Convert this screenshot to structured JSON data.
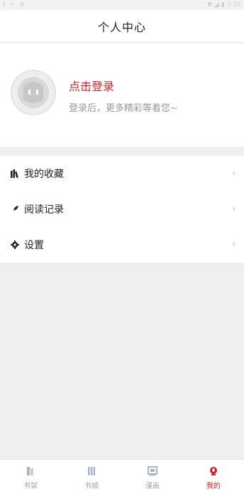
{
  "status_bar": {
    "left_icons": [
      "info-icon",
      "plus-icon",
      "settings-icon"
    ],
    "time": "3:28"
  },
  "header": {
    "title": "个人中心"
  },
  "profile": {
    "login_label": "点击登录",
    "login_subtitle": "登录后，更多精彩等着您~",
    "login_color": "#d0202a"
  },
  "menu": {
    "items": [
      {
        "label": "我的收藏",
        "icon": "books-icon"
      },
      {
        "label": "阅读记录",
        "icon": "feather-icon"
      },
      {
        "label": "设置",
        "icon": "gear-icon"
      }
    ],
    "chevron": "›"
  },
  "tabbar": {
    "items": [
      {
        "label": "书架",
        "icon": "bookshelf-icon"
      },
      {
        "label": "书城",
        "icon": "bookstore-icon"
      },
      {
        "label": "漫画",
        "icon": "comic-icon"
      },
      {
        "label": "我的",
        "icon": "profile-icon",
        "active": true
      }
    ],
    "active_color": "#d0202a",
    "inactive_color": "#a4a4a4"
  }
}
